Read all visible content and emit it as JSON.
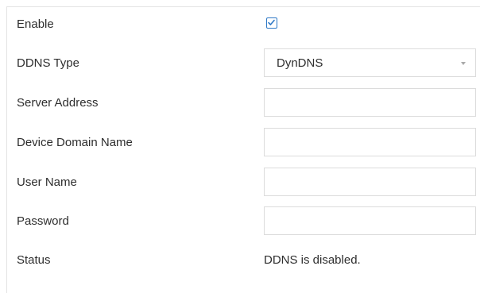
{
  "form": {
    "enable": {
      "label": "Enable",
      "checked": true
    },
    "ddns_type": {
      "label": "DDNS Type",
      "selected": "DynDNS"
    },
    "server_address": {
      "label": "Server Address",
      "value": ""
    },
    "device_domain_name": {
      "label": "Device Domain Name",
      "value": ""
    },
    "user_name": {
      "label": "User Name",
      "value": ""
    },
    "password": {
      "label": "Password",
      "value": ""
    },
    "status": {
      "label": "Status",
      "value": "DDNS is disabled."
    }
  },
  "colors": {
    "checkbox_accent": "#2f79c6",
    "border": "#dcdcdc"
  },
  "icons": {
    "checkbox": "checkmark-icon",
    "dropdown": "chevron-down-icon"
  }
}
